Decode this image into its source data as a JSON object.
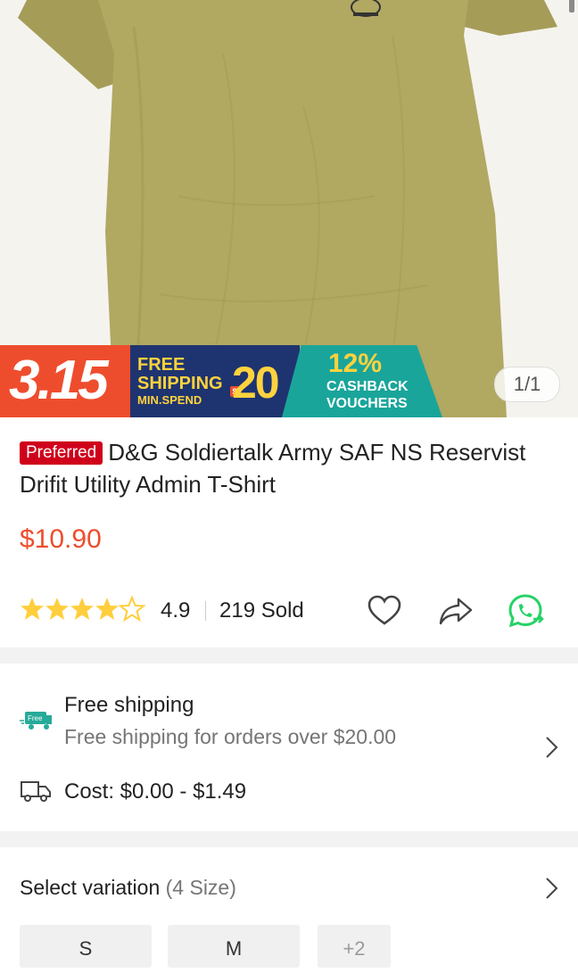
{
  "banner": {
    "sale_date": "3.15",
    "free_line": "FREE",
    "shipping_line": "SHIPPING",
    "min_spend": "MIN.SPEND",
    "currency_badge": "$",
    "min_amount": "20",
    "cashback_pct": "12%",
    "cashback_line": "CASHBACK",
    "vouchers_line": "VOUCHERS",
    "colors": {
      "red": "#ee4d2d",
      "navy": "#1e3470",
      "teal": "#1aa59a",
      "yellow": "#ffd23e"
    }
  },
  "gallery": {
    "counter": "1/1"
  },
  "product": {
    "badge": "Preferred",
    "title": "D&G Soldiertalk Army SAF NS Reservist Drifit Utility Admin T-Shirt",
    "price": "$10.90",
    "rating": "4.9",
    "rating_stars": 4.5,
    "sold": "219 Sold"
  },
  "actions": {
    "like_icon": "heart-icon",
    "share_icon": "share-arrow-icon",
    "whatsapp_icon": "whatsapp-icon"
  },
  "shipping": {
    "free_badge": "Free",
    "title": "Free shipping",
    "subtitle": "Free shipping for orders over $20.00",
    "cost": "Cost: $0.00 - $1.49"
  },
  "variation": {
    "label": "Select variation",
    "count": "(4 Size)",
    "options": [
      "S",
      "M"
    ],
    "more": "+2"
  },
  "theme": {
    "accent": "#ee4d2d",
    "shirt": "#b1a862",
    "whatsapp": "#25d366"
  }
}
